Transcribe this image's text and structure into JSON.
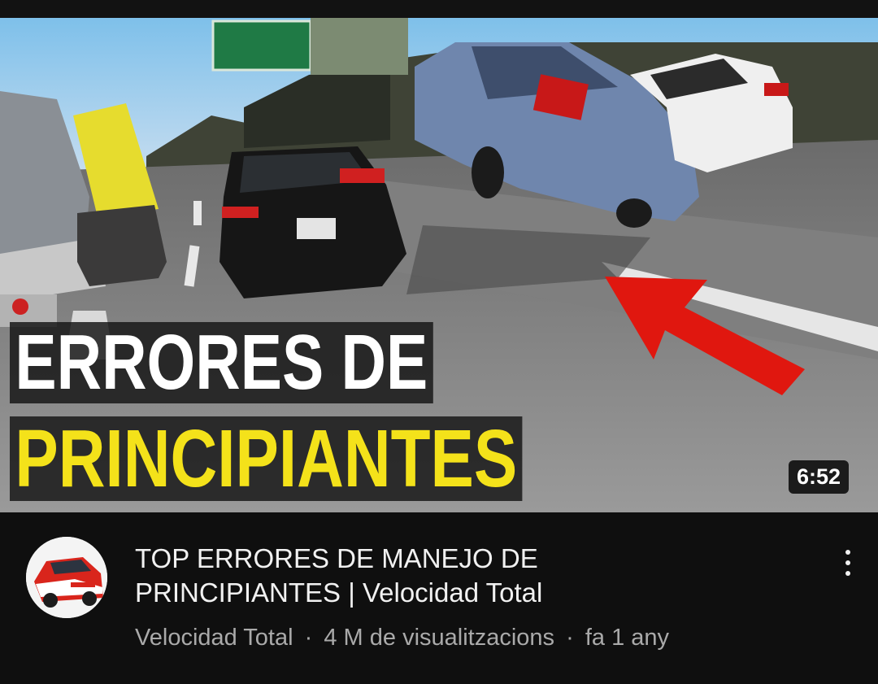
{
  "video": {
    "overlay_line1": "ERRORES DE",
    "overlay_line2": "PRINCIPIANTES",
    "duration": "6:52",
    "title_line1": "TOP ERRORES DE MANEJO DE",
    "title_line2": "PRINCIPIANTES | Velocidad Total",
    "channel": "Velocidad Total",
    "separator": "·",
    "views": "4 M de visualitzacions",
    "age": "fa 1 any"
  },
  "icons": {
    "more": "more-vert-icon",
    "annotation": "red-arrow-annotation"
  },
  "colors": {
    "background": "#0f0f0f",
    "title_text": "#f1f1f1",
    "meta_text": "#aaaaaa",
    "overlay_yellow": "#f4e21a",
    "arrow_red": "#e0170f"
  }
}
